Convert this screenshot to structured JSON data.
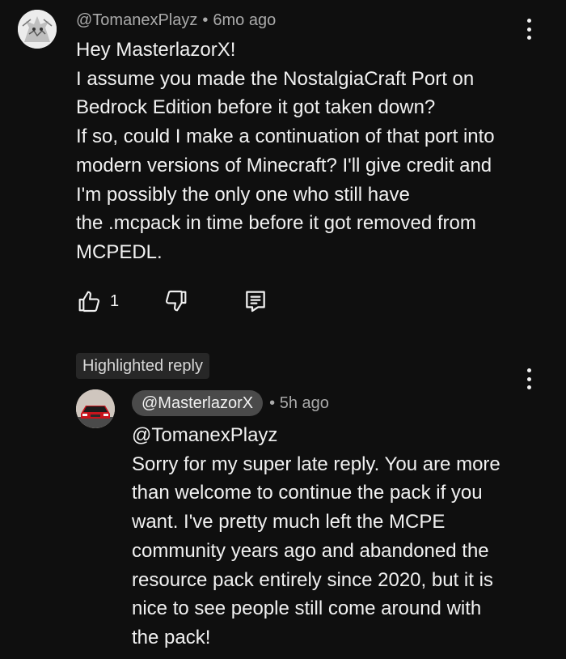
{
  "comment": {
    "author": "@TomanexPlayz",
    "separator": "•",
    "time": "6mo ago",
    "lines": [
      "Hey MasterlazorX!",
      "I assume you made the NostalgiaCraft Port on",
      "Bedrock Edition before it got taken down?",
      "If so, could I make a continuation of that port into",
      "modern versions of Minecraft? I'll give credit and",
      "I'm possibly the only one who still have",
      "the .mcpack in time before it got removed from",
      "MCPEDL."
    ],
    "like_count": "1",
    "icons": {
      "like": "thumbs-up-icon",
      "dislike": "thumbs-down-icon",
      "reply": "reply-comment-icon",
      "menu": "more-vertical-icon"
    }
  },
  "highlighted_label": "Highlighted reply",
  "reply": {
    "author": "@MasterlazorX",
    "separator": "•",
    "time": "5h ago",
    "lines": [
      "@TomanexPlayz",
      "Sorry for my super late reply. You are more",
      "than welcome to continue the pack if you",
      "want. I've pretty much left the MCPE",
      "community years ago and abandoned the",
      "resource pack entirely since 2020, but it is",
      "nice to see people still come around with",
      "the pack!"
    ]
  },
  "colors": {
    "background": "#0f0f0f",
    "text": "#f1f1f1",
    "muted": "#aaaaaa",
    "chip": "#272727",
    "author_badge": "#4a4a4a"
  }
}
